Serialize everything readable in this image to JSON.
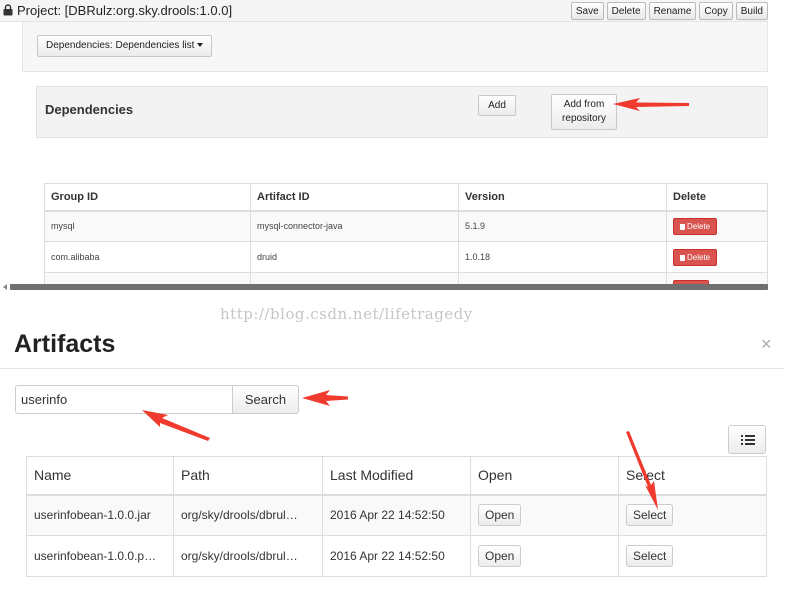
{
  "project": {
    "title": "Project: [DBRulz:org.sky.drools:1.0.0]",
    "toolbar": [
      "Save",
      "Delete",
      "Rename",
      "Copy",
      "Build"
    ]
  },
  "dependencies": {
    "view_dropdown": "Dependencies: Dependencies list",
    "section_title": "Dependencies",
    "add_label": "Add",
    "add_repo_label": "Add from\nrepository",
    "columns": [
      "Group ID",
      "Artifact ID",
      "Version",
      "Delete"
    ],
    "rows": [
      {
        "group": "mysql",
        "artifact": "mysql-connector-java",
        "version": "5.1.9",
        "action": "Delete"
      },
      {
        "group": "com.alibaba",
        "artifact": "druid",
        "version": "1.0.18",
        "action": "Delete"
      }
    ]
  },
  "watermark": "http://blog.csdn.net/lifetragedy",
  "artifacts": {
    "title": "Artifacts",
    "close_symbol": "×",
    "search": {
      "value": "userinfo",
      "button": "Search"
    },
    "columns": [
      "Name",
      "Path",
      "Last Modified",
      "Open",
      "Select"
    ],
    "rows": [
      {
        "name": "userinfobean-1.0.0.jar",
        "path": "org/sky/drools/dbrul…",
        "modified": "2016 Apr 22 14:52:50",
        "open": "Open",
        "select": "Select"
      },
      {
        "name": "userinfobean-1.0.0.p…",
        "path": "org/sky/drools/dbrul…",
        "modified": "2016 Apr 22 14:52:50",
        "open": "Open",
        "select": "Select"
      }
    ]
  },
  "colors": {
    "delete_red": "#d9534f",
    "annotation_red": "#f03a2e"
  },
  "icons": [
    "lock-icon",
    "caret-down-icon",
    "trash-icon",
    "close-icon",
    "list-icon"
  ]
}
